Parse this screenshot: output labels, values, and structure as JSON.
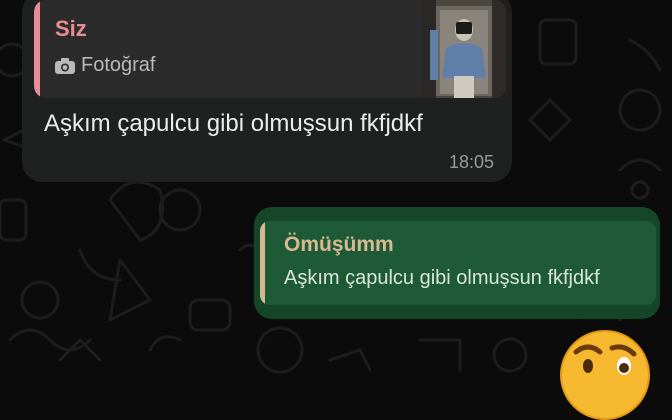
{
  "incoming": {
    "quote": {
      "sender": "Siz",
      "media_label": "Fotoğraf",
      "media_icon": "camera-icon"
    },
    "text": "Aşkım çapulcu gibi olmuşsun fkfjdkf",
    "time": "18:05"
  },
  "outgoing": {
    "quote": {
      "sender": "Ömüşümm",
      "preview": "Aşkım çapulcu gibi olmuşsun fkfjdkf"
    }
  },
  "reaction": {
    "icon": "raised-eyebrow-emoji"
  },
  "colors": {
    "background": "#0b0b0b",
    "incoming_bubble": "#1f2020",
    "incoming_quote": "#2b2b2b",
    "incoming_quote_accent": "#e88c95",
    "outgoing_bubble": "#15462a",
    "outgoing_quote": "#1f5a37",
    "outgoing_quote_accent": "#d7b98f"
  }
}
